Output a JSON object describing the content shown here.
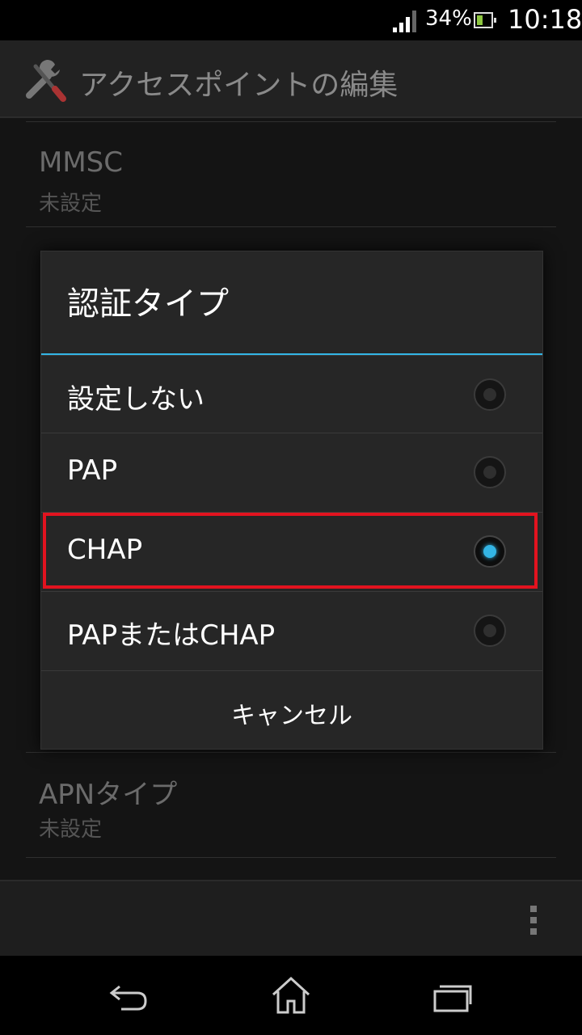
{
  "status_bar": {
    "battery_percent": "34%",
    "time": "10:18",
    "icons": [
      "signal-icon",
      "battery-icon"
    ]
  },
  "action_bar": {
    "title": "アクセスポイントの編集",
    "icon": "wrench-screwdriver-icon"
  },
  "background_list": {
    "items": [
      {
        "title": "MMSC",
        "subtitle": "未設定"
      },
      {
        "title": "APNタイプ",
        "subtitle": "未設定"
      }
    ]
  },
  "dialog": {
    "title": "認証タイプ",
    "accent_color": "#33b5e5",
    "highlight_color": "#e2131f",
    "options": [
      {
        "label": "設定しない",
        "selected": false
      },
      {
        "label": "PAP",
        "selected": false
      },
      {
        "label": "CHAP",
        "selected": true
      },
      {
        "label": "PAPまたはCHAP",
        "selected": false
      }
    ],
    "cancel_label": "キャンセル"
  },
  "navigation": {
    "icons": [
      "back-icon",
      "home-icon",
      "recent-apps-icon"
    ]
  }
}
